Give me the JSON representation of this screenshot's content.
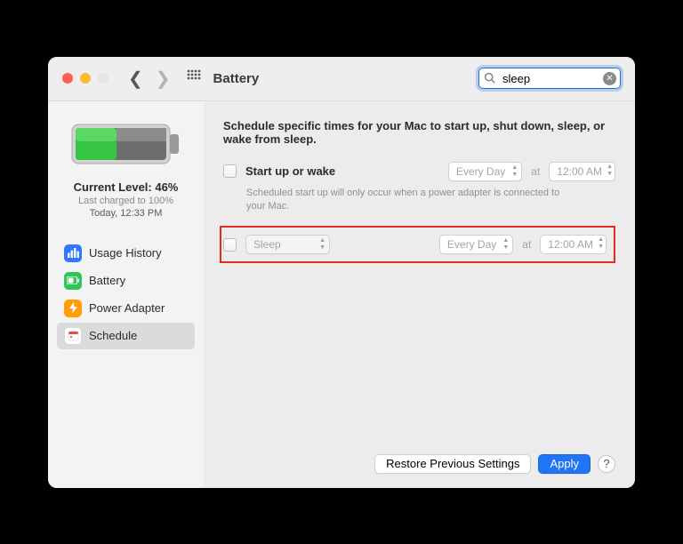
{
  "header": {
    "title": "Battery",
    "search_value": "sleep"
  },
  "sidebar": {
    "level_label": "Current Level: 46%",
    "last_charged": "Last charged to 100%",
    "last_when": "Today, 12:33 PM",
    "items": [
      {
        "label": "Usage History"
      },
      {
        "label": "Battery"
      },
      {
        "label": "Power Adapter"
      },
      {
        "label": "Schedule"
      }
    ]
  },
  "main": {
    "description": "Schedule specific times for your Mac to start up, shut down, sleep, or wake from sleep.",
    "startup": {
      "label": "Start up or wake",
      "day": "Every Day",
      "at": "at",
      "time": "12:00 AM",
      "note": "Scheduled start up will only occur when a power adapter is connected to your Mac."
    },
    "sleep": {
      "action": "Sleep",
      "day": "Every Day",
      "at": "at",
      "time": "12:00 AM"
    }
  },
  "footer": {
    "restore": "Restore Previous Settings",
    "apply": "Apply",
    "help": "?"
  }
}
